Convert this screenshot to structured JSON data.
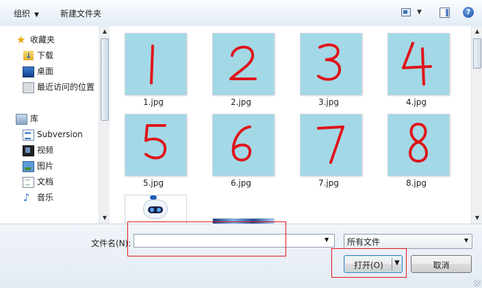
{
  "toolbar": {
    "organize_label": "组织",
    "new_folder_label": "新建文件夹",
    "view_icon": "view-icon",
    "preview_icon": "preview-pane-icon",
    "help_icon": "help-icon",
    "help_glyph": "?"
  },
  "nav": {
    "favorites": [
      {
        "label": "收藏夹",
        "icon": "star-icon"
      },
      {
        "label": "下载",
        "icon": "download-folder-icon"
      },
      {
        "label": "桌面",
        "icon": "desktop-icon"
      },
      {
        "label": "最近访问的位置",
        "icon": "recent-places-icon"
      }
    ],
    "libraries": [
      {
        "label": "库",
        "icon": "library-icon"
      },
      {
        "label": "Subversion",
        "icon": "subversion-icon"
      },
      {
        "label": "视频",
        "icon": "video-icon"
      },
      {
        "label": "图片",
        "icon": "pictures-icon"
      },
      {
        "label": "文档",
        "icon": "documents-icon"
      },
      {
        "label": "音乐",
        "icon": "music-icon"
      }
    ]
  },
  "files": [
    {
      "name": "1.jpg",
      "digit": "1"
    },
    {
      "name": "2.jpg",
      "digit": "2"
    },
    {
      "name": "3.jpg",
      "digit": "3"
    },
    {
      "name": "4.jpg",
      "digit": "4"
    },
    {
      "name": "5.jpg",
      "digit": "5"
    },
    {
      "name": "6.jpg",
      "digit": "6"
    },
    {
      "name": "7.jpg",
      "digit": "7"
    },
    {
      "name": "8.jpg",
      "digit": "8"
    }
  ],
  "bottom": {
    "filename_label": "文件名(N):",
    "filename_value": "",
    "filetype_value": "所有文件",
    "open_label": "打开(O)",
    "cancel_label": "取消"
  },
  "colors": {
    "thumbnail_bg": "#a3d8e6",
    "digit_red": "#e0141a",
    "highlight_red": "#e0141a"
  }
}
